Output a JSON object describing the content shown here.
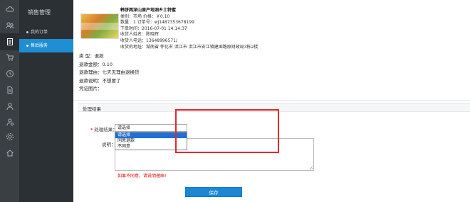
{
  "sidebar": {
    "title": "销售管理",
    "items": [
      {
        "label": "我的订单",
        "active": false
      },
      {
        "label": "售后服务",
        "active": true
      }
    ],
    "rail_icons": [
      "cloud-icon",
      "people-icon",
      "document-icon",
      "cart-icon",
      "clock-icon",
      "file-icon",
      "user-icon",
      "settings-icon",
      "home-icon"
    ]
  },
  "product": {
    "name": "韩饼两深山原产地洞乡土特蜜",
    "spec_line": "类别：市场  价格：￥0.10",
    "order_line": "数量：1  订单号：wj1487353678199",
    "time_line": "下单时间：2016-07-01 14:14:37",
    "receiver_name": "收货人姓名：陈晓辉",
    "receiver_phone": "收货人电话：13648996571/",
    "receiver_address": "收货的地址：湖南省  怀化市  洪江市  洪江市安江镇建国路原财政局3栋2楼"
  },
  "refund": {
    "type": "类        型：退款",
    "amount": "退款金额：0.10",
    "reason": "退款理由：七天无理由退换货",
    "note": "退款说明：不想要了",
    "proof": "凭证图片："
  },
  "result": {
    "section_title": "处理结果",
    "label": "处理结果：",
    "required_mark": "*",
    "select_value": "请选择",
    "options": [
      "请选择",
      "同意退款",
      "不同意"
    ],
    "selected_index": 0,
    "desc_label": "说明：",
    "hint": "如果不同意，请说明理由!",
    "save_label": "保存"
  },
  "colors": {
    "accent": "#1b87d6",
    "highlight_border": "#e8262a",
    "hint": "#d40000",
    "rail": "#3a3f44",
    "menu": "#2b3035"
  }
}
